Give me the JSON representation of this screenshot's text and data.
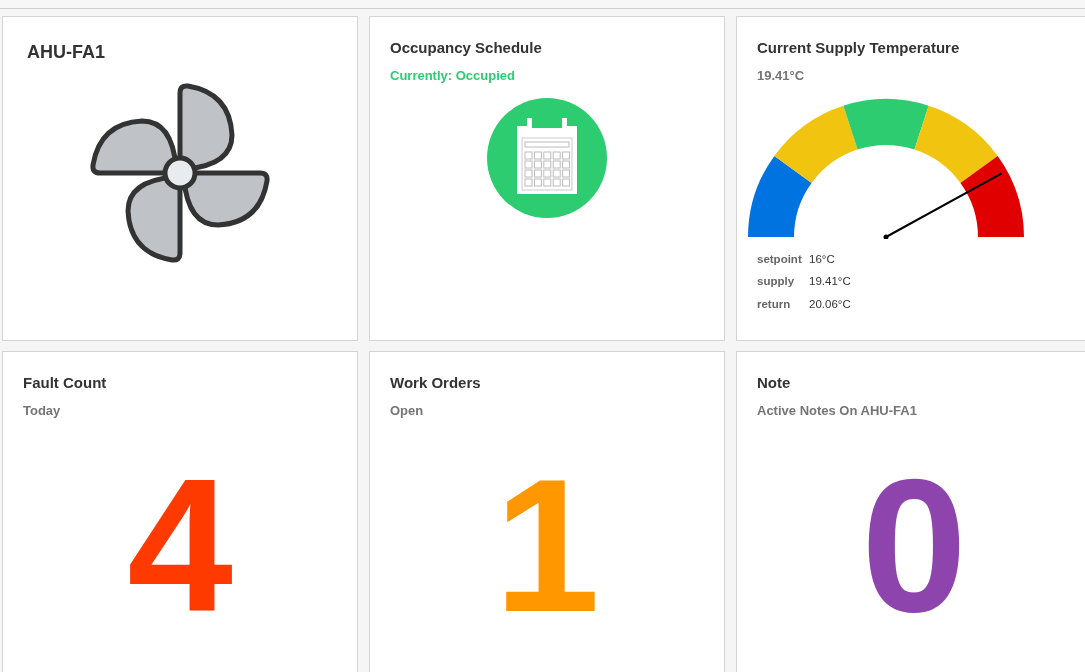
{
  "cards": [
    {
      "kind": "fan",
      "title": "AHU-FA1"
    },
    {
      "kind": "schedule",
      "title": "Occupancy Schedule",
      "subtitle": "Currently: Occupied",
      "occupied": true
    },
    {
      "kind": "gauge",
      "title": "Current Supply Temperature",
      "subtitle": "19.41°C",
      "readings": [
        {
          "label": "setpoint",
          "value": "16°C"
        },
        {
          "label": "supply",
          "value": "19.41°C"
        },
        {
          "label": "return",
          "value": "20.06°C"
        }
      ]
    },
    {
      "kind": "count",
      "title": "Fault Count",
      "subtitle": "Today",
      "value": "4",
      "color": "#ff3a00"
    },
    {
      "kind": "count",
      "title": "Work Orders",
      "subtitle": "Open",
      "value": "1",
      "color": "#ff9800"
    },
    {
      "kind": "count",
      "title": "Note",
      "subtitle": "Active Notes On AHU-FA1",
      "value": "0",
      "color": "#8e44ad"
    }
  ]
}
